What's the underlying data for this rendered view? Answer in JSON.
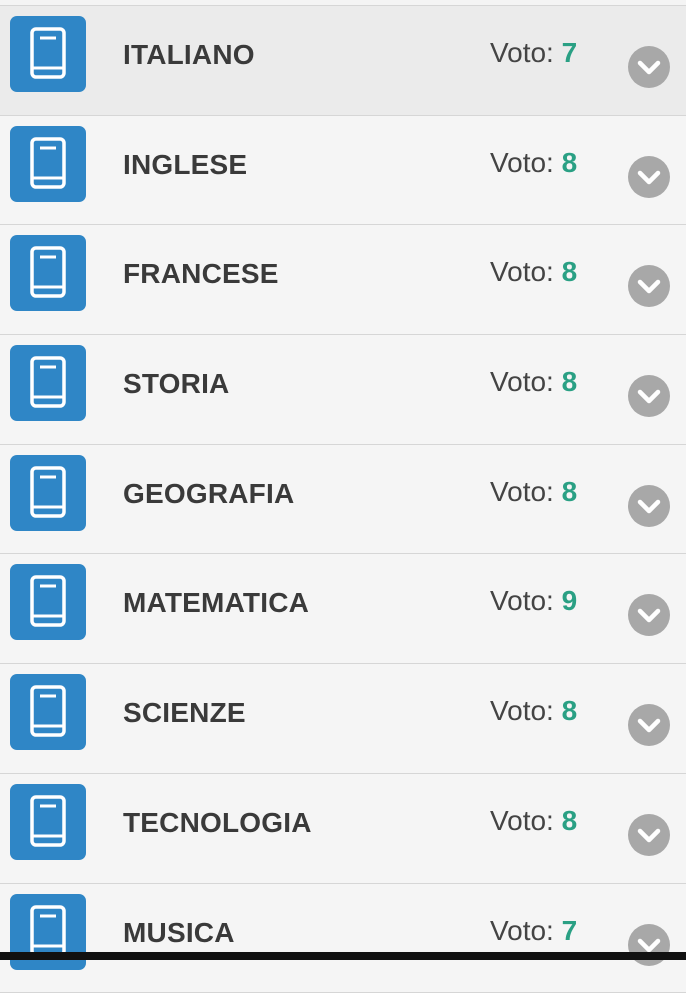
{
  "grade_label": "Voto: ",
  "colors": {
    "icon_blue": "#2f86c6",
    "grade_green": "#2aa084",
    "chevron_gray": "#a8a8a8"
  },
  "subjects": [
    {
      "name": "ITALIANO",
      "grade": "7",
      "icon": "book-icon"
    },
    {
      "name": "INGLESE",
      "grade": "8",
      "icon": "book-icon"
    },
    {
      "name": "FRANCESE",
      "grade": "8",
      "icon": "book-icon"
    },
    {
      "name": "STORIA",
      "grade": "8",
      "icon": "book-icon"
    },
    {
      "name": "GEOGRAFIA",
      "grade": "8",
      "icon": "book-icon"
    },
    {
      "name": "MATEMATICA",
      "grade": "9",
      "icon": "book-icon"
    },
    {
      "name": "SCIENZE",
      "grade": "8",
      "icon": "book-icon"
    },
    {
      "name": "TECNOLOGIA",
      "grade": "8",
      "icon": "book-icon"
    },
    {
      "name": "MUSICA",
      "grade": "7",
      "icon": "book-icon"
    }
  ]
}
